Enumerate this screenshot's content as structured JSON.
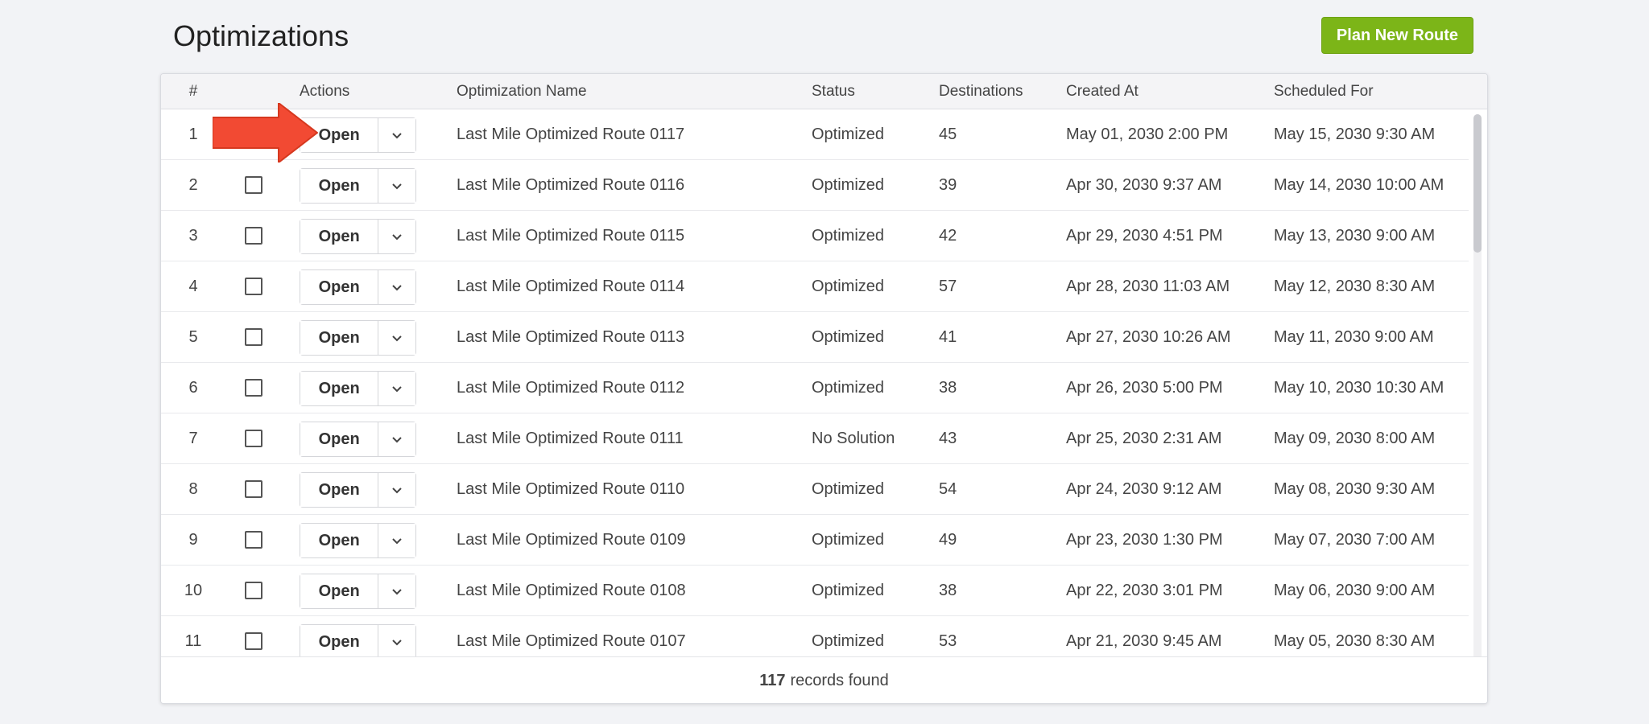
{
  "page": {
    "title": "Optimizations",
    "plan_button_label": "Plan New Route"
  },
  "table": {
    "columns": {
      "index": "#",
      "actions": "Actions",
      "name": "Optimization Name",
      "status": "Status",
      "destinations": "Destinations",
      "created_at": "Created At",
      "scheduled_for": "Scheduled For"
    },
    "open_label": "Open",
    "rows": [
      {
        "num": "1",
        "name": "Last Mile Optimized Route 0117",
        "status": "Optimized",
        "destinations": "45",
        "created": "May 01, 2030 2:00 PM",
        "scheduled": "May 15, 2030 9:30 AM"
      },
      {
        "num": "2",
        "name": "Last Mile Optimized Route 0116",
        "status": "Optimized",
        "destinations": "39",
        "created": "Apr 30, 2030 9:37 AM",
        "scheduled": "May 14, 2030 10:00 AM"
      },
      {
        "num": "3",
        "name": "Last Mile Optimized Route 0115",
        "status": "Optimized",
        "destinations": "42",
        "created": "Apr 29, 2030 4:51 PM",
        "scheduled": "May 13, 2030 9:00 AM"
      },
      {
        "num": "4",
        "name": "Last Mile Optimized Route 0114",
        "status": "Optimized",
        "destinations": "57",
        "created": "Apr 28, 2030 11:03 AM",
        "scheduled": "May 12, 2030 8:30 AM"
      },
      {
        "num": "5",
        "name": "Last Mile Optimized Route 0113",
        "status": "Optimized",
        "destinations": "41",
        "created": "Apr 27, 2030 10:26 AM",
        "scheduled": "May 11, 2030 9:00 AM"
      },
      {
        "num": "6",
        "name": "Last Mile Optimized Route 0112",
        "status": "Optimized",
        "destinations": "38",
        "created": "Apr 26, 2030 5:00 PM",
        "scheduled": "May 10, 2030 10:30 AM"
      },
      {
        "num": "7",
        "name": "Last Mile Optimized Route 0111",
        "status": "No Solution",
        "destinations": "43",
        "created": "Apr 25, 2030 2:31 AM",
        "scheduled": "May 09, 2030 8:00 AM"
      },
      {
        "num": "8",
        "name": "Last Mile Optimized Route 0110",
        "status": "Optimized",
        "destinations": "54",
        "created": "Apr 24, 2030 9:12 AM",
        "scheduled": "May 08, 2030 9:30 AM"
      },
      {
        "num": "9",
        "name": "Last Mile Optimized Route 0109",
        "status": "Optimized",
        "destinations": "49",
        "created": "Apr 23, 2030 1:30 PM",
        "scheduled": "May 07, 2030 7:00 AM"
      },
      {
        "num": "10",
        "name": "Last Mile Optimized Route 0108",
        "status": "Optimized",
        "destinations": "38",
        "created": "Apr 22, 2030 3:01 PM",
        "scheduled": "May 06, 2030 9:00 AM"
      },
      {
        "num": "11",
        "name": "Last Mile Optimized Route 0107",
        "status": "Optimized",
        "destinations": "53",
        "created": "Apr 21, 2030 9:45 AM",
        "scheduled": "May 05, 2030 8:30 AM"
      }
    ]
  },
  "footer": {
    "record_count": "117",
    "records_label": "records found"
  },
  "icons": {
    "dropdown": "chevron-down-icon",
    "annotation": "red-arrow-icon"
  },
  "colors": {
    "accent": "#7cb518",
    "arrow": "#f24a33"
  }
}
